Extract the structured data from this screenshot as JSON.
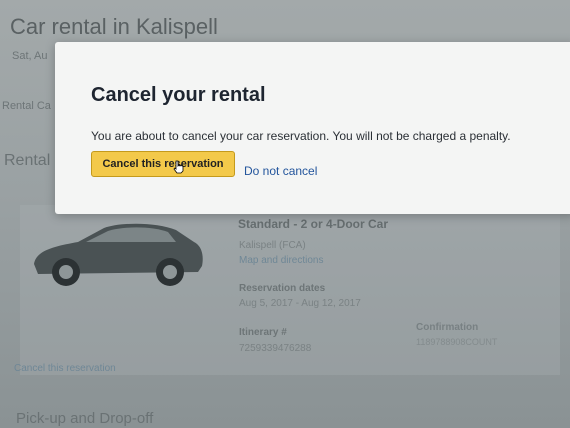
{
  "background": {
    "page_title": "Car rental in Kalispell",
    "date_fragment": "Sat, Au",
    "tab_fragment": "Rental Ca",
    "section_fragment": "Rental",
    "car": {
      "type": "Standard - 2 or 4-Door Car",
      "location": "Kalispell (FCA)",
      "map_link": "Map and directions"
    },
    "reservation": {
      "dates_label": "Reservation dates",
      "dates": "Aug 5, 2017 - Aug 12, 2017",
      "itinerary_label": "Itinerary #",
      "itinerary": "7259339476288",
      "confirmation_label": "Confirmation",
      "confirmation": "1189788908COUNT"
    },
    "cancel_link": "Cancel this reservation",
    "pickup_heading": "Pick-up and Drop-off"
  },
  "modal": {
    "title": "Cancel your rental",
    "message": "You are about to cancel your car reservation. You will not be charged a penalty.",
    "confirm_button": "Cancel this reservation",
    "keep_link": "Do not cancel"
  },
  "colors": {
    "button_accent": "#f3c94a",
    "link": "#23559c"
  }
}
